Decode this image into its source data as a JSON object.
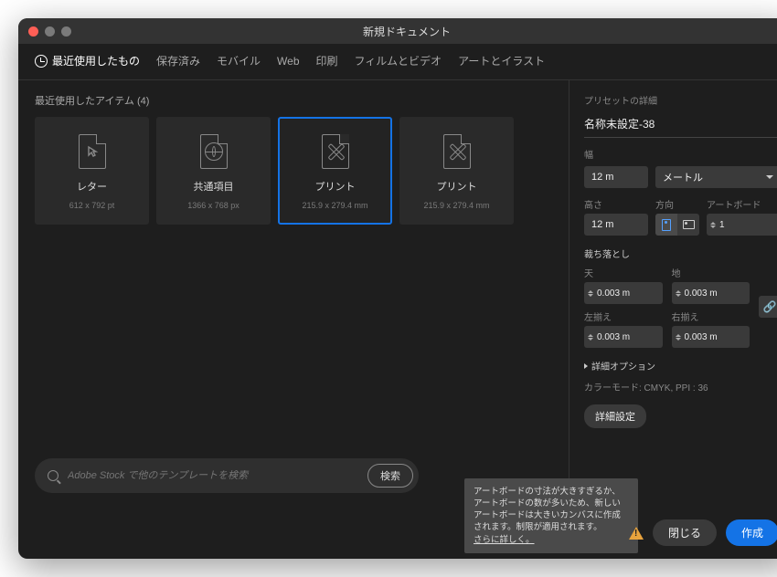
{
  "title": "新規ドキュメント",
  "tabs": [
    {
      "label": "最近使用したもの"
    },
    {
      "label": "保存済み"
    },
    {
      "label": "モバイル"
    },
    {
      "label": "Web"
    },
    {
      "label": "印刷"
    },
    {
      "label": "フィルムとビデオ"
    },
    {
      "label": "アートとイラスト"
    }
  ],
  "recent_header": "最近使用したアイテム (4)",
  "cards": [
    {
      "title": "レター",
      "sub": "612 x 792 pt"
    },
    {
      "title": "共通項目",
      "sub": "1366 x 768 px"
    },
    {
      "title": "プリント",
      "sub": "215.9 x 279.4 mm"
    },
    {
      "title": "プリント",
      "sub": "215.9 x 279.4 mm"
    }
  ],
  "search": {
    "placeholder": "Adobe Stock で他のテンプレートを検索",
    "button": "検索"
  },
  "panel": {
    "header": "プリセットの詳細",
    "name": "名称未設定-38",
    "width_label": "幅",
    "width_value": "12 m",
    "unit": "メートル",
    "height_label": "高さ",
    "height_value": "12 m",
    "orientation_label": "方向",
    "artboards_label": "アートボード",
    "artboards_value": "1",
    "bleed_header": "裁ち落とし",
    "top_label": "天",
    "bottom_label": "地",
    "left_label": "左揃え",
    "right_label": "右揃え",
    "bleed_value": "0.003 m",
    "advanced_toggle": "詳細オプション",
    "mode_line": "カラーモード: CMYK, PPI : 36",
    "advanced_button": "詳細設定"
  },
  "tooltip": {
    "text": "アートボードの寸法が大きすぎるか、アートボードの数が多いため、新しいアートボードは大きいカンバスに作成されます。制限が適用されます。",
    "link": "さらに詳しく。"
  },
  "actions": {
    "close": "閉じる",
    "create": "作成"
  }
}
